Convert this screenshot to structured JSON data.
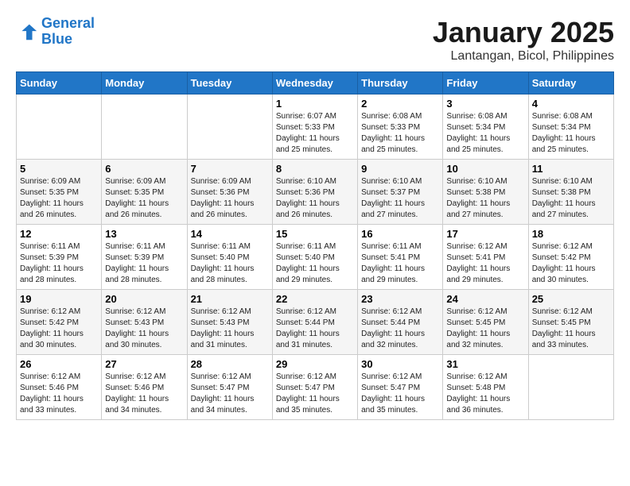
{
  "header": {
    "logo_line1": "General",
    "logo_line2": "Blue",
    "month_title": "January 2025",
    "subtitle": "Lantangan, Bicol, Philippines"
  },
  "weekdays": [
    "Sunday",
    "Monday",
    "Tuesday",
    "Wednesday",
    "Thursday",
    "Friday",
    "Saturday"
  ],
  "weeks": [
    [
      {
        "day": "",
        "info": ""
      },
      {
        "day": "",
        "info": ""
      },
      {
        "day": "",
        "info": ""
      },
      {
        "day": "1",
        "info": "Sunrise: 6:07 AM\nSunset: 5:33 PM\nDaylight: 11 hours\nand 25 minutes."
      },
      {
        "day": "2",
        "info": "Sunrise: 6:08 AM\nSunset: 5:33 PM\nDaylight: 11 hours\nand 25 minutes."
      },
      {
        "day": "3",
        "info": "Sunrise: 6:08 AM\nSunset: 5:34 PM\nDaylight: 11 hours\nand 25 minutes."
      },
      {
        "day": "4",
        "info": "Sunrise: 6:08 AM\nSunset: 5:34 PM\nDaylight: 11 hours\nand 25 minutes."
      }
    ],
    [
      {
        "day": "5",
        "info": "Sunrise: 6:09 AM\nSunset: 5:35 PM\nDaylight: 11 hours\nand 26 minutes."
      },
      {
        "day": "6",
        "info": "Sunrise: 6:09 AM\nSunset: 5:35 PM\nDaylight: 11 hours\nand 26 minutes."
      },
      {
        "day": "7",
        "info": "Sunrise: 6:09 AM\nSunset: 5:36 PM\nDaylight: 11 hours\nand 26 minutes."
      },
      {
        "day": "8",
        "info": "Sunrise: 6:10 AM\nSunset: 5:36 PM\nDaylight: 11 hours\nand 26 minutes."
      },
      {
        "day": "9",
        "info": "Sunrise: 6:10 AM\nSunset: 5:37 PM\nDaylight: 11 hours\nand 27 minutes."
      },
      {
        "day": "10",
        "info": "Sunrise: 6:10 AM\nSunset: 5:38 PM\nDaylight: 11 hours\nand 27 minutes."
      },
      {
        "day": "11",
        "info": "Sunrise: 6:10 AM\nSunset: 5:38 PM\nDaylight: 11 hours\nand 27 minutes."
      }
    ],
    [
      {
        "day": "12",
        "info": "Sunrise: 6:11 AM\nSunset: 5:39 PM\nDaylight: 11 hours\nand 28 minutes."
      },
      {
        "day": "13",
        "info": "Sunrise: 6:11 AM\nSunset: 5:39 PM\nDaylight: 11 hours\nand 28 minutes."
      },
      {
        "day": "14",
        "info": "Sunrise: 6:11 AM\nSunset: 5:40 PM\nDaylight: 11 hours\nand 28 minutes."
      },
      {
        "day": "15",
        "info": "Sunrise: 6:11 AM\nSunset: 5:40 PM\nDaylight: 11 hours\nand 29 minutes."
      },
      {
        "day": "16",
        "info": "Sunrise: 6:11 AM\nSunset: 5:41 PM\nDaylight: 11 hours\nand 29 minutes."
      },
      {
        "day": "17",
        "info": "Sunrise: 6:12 AM\nSunset: 5:41 PM\nDaylight: 11 hours\nand 29 minutes."
      },
      {
        "day": "18",
        "info": "Sunrise: 6:12 AM\nSunset: 5:42 PM\nDaylight: 11 hours\nand 30 minutes."
      }
    ],
    [
      {
        "day": "19",
        "info": "Sunrise: 6:12 AM\nSunset: 5:42 PM\nDaylight: 11 hours\nand 30 minutes."
      },
      {
        "day": "20",
        "info": "Sunrise: 6:12 AM\nSunset: 5:43 PM\nDaylight: 11 hours\nand 30 minutes."
      },
      {
        "day": "21",
        "info": "Sunrise: 6:12 AM\nSunset: 5:43 PM\nDaylight: 11 hours\nand 31 minutes."
      },
      {
        "day": "22",
        "info": "Sunrise: 6:12 AM\nSunset: 5:44 PM\nDaylight: 11 hours\nand 31 minutes."
      },
      {
        "day": "23",
        "info": "Sunrise: 6:12 AM\nSunset: 5:44 PM\nDaylight: 11 hours\nand 32 minutes."
      },
      {
        "day": "24",
        "info": "Sunrise: 6:12 AM\nSunset: 5:45 PM\nDaylight: 11 hours\nand 32 minutes."
      },
      {
        "day": "25",
        "info": "Sunrise: 6:12 AM\nSunset: 5:45 PM\nDaylight: 11 hours\nand 33 minutes."
      }
    ],
    [
      {
        "day": "26",
        "info": "Sunrise: 6:12 AM\nSunset: 5:46 PM\nDaylight: 11 hours\nand 33 minutes."
      },
      {
        "day": "27",
        "info": "Sunrise: 6:12 AM\nSunset: 5:46 PM\nDaylight: 11 hours\nand 34 minutes."
      },
      {
        "day": "28",
        "info": "Sunrise: 6:12 AM\nSunset: 5:47 PM\nDaylight: 11 hours\nand 34 minutes."
      },
      {
        "day": "29",
        "info": "Sunrise: 6:12 AM\nSunset: 5:47 PM\nDaylight: 11 hours\nand 35 minutes."
      },
      {
        "day": "30",
        "info": "Sunrise: 6:12 AM\nSunset: 5:47 PM\nDaylight: 11 hours\nand 35 minutes."
      },
      {
        "day": "31",
        "info": "Sunrise: 6:12 AM\nSunset: 5:48 PM\nDaylight: 11 hours\nand 36 minutes."
      },
      {
        "day": "",
        "info": ""
      }
    ]
  ]
}
